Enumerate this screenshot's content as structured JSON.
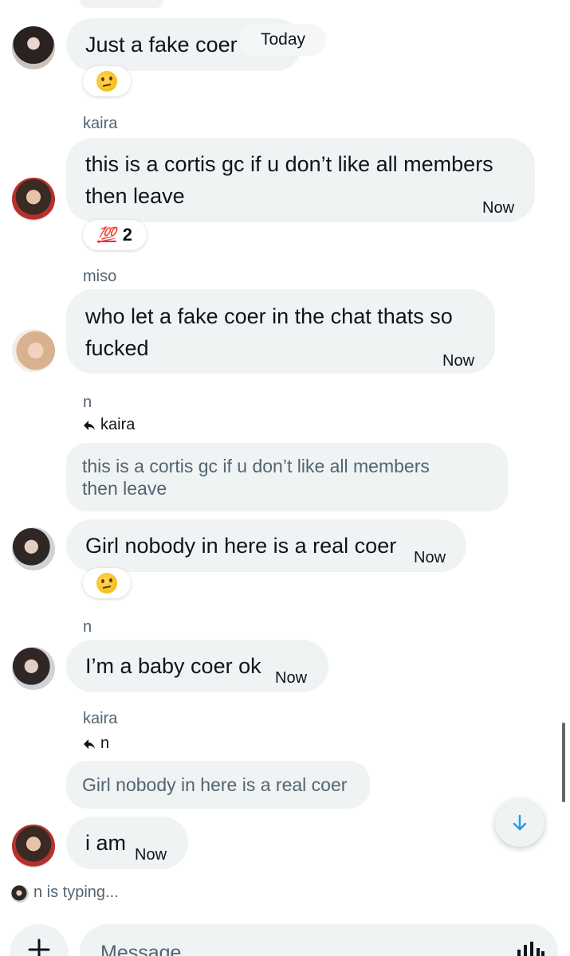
{
  "top": {
    "date_chip": "Today",
    "first_message": "Just a fake coer",
    "first_reaction": "thinking-face"
  },
  "messages": {
    "kaira_label": "kaira",
    "m2_text_line1": "this is a cortis gc if u don’t like all members",
    "m2_text_line2": "then leave",
    "m2_time": "Now",
    "m2_reaction_count": "2",
    "m2_reaction_emoji": "💯",
    "miso_label": "miso",
    "m3_text_line1": "who let a fake coer in the chat thats so",
    "m3_text_line2": "fucked",
    "m3_time": "Now",
    "n_label_1": "n",
    "reply_to_1": "kaira",
    "quote_1_line1": "this is a cortis gc if u don’t like all members",
    "quote_1_line2": "then leave",
    "m4_text": "Girl nobody in here is a real coer",
    "m4_time": "Now",
    "n_label_2": "n",
    "m5_text": "I’m a baby coer ok",
    "m5_time": "Now",
    "kaira_label_2": "kaira",
    "reply_to_2": "n",
    "quote_2": "Girl nobody in here is a real coer",
    "m6_text": "i am",
    "m6_time": "Now"
  },
  "typing": {
    "text": "n is typing..."
  },
  "composer": {
    "placeholder": "Message"
  },
  "colors": {
    "bubble": "#eff3f4",
    "accent": "#1d9bf0",
    "muted": "#536471"
  }
}
